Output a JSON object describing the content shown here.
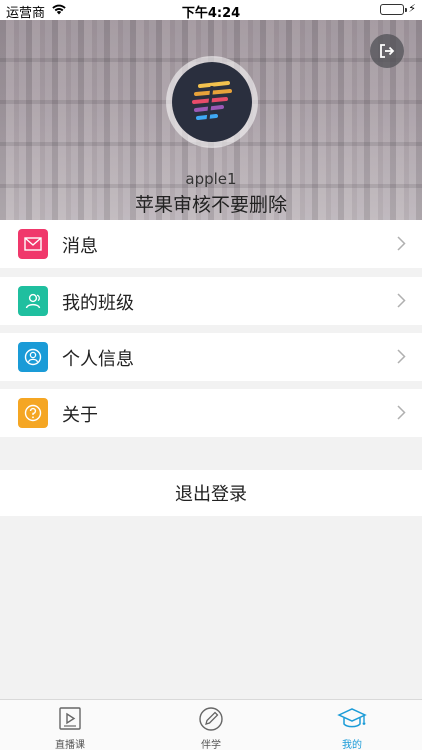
{
  "status_bar": {
    "carrier": "运营商",
    "time": "下午4:24",
    "battery_percent": 100
  },
  "profile": {
    "username": "apple1",
    "signature": "苹果审核不要删除",
    "logout_icon": "logout-icon"
  },
  "menu": {
    "items": [
      {
        "label": "消息",
        "icon": "mail-icon",
        "color": "#f0386b"
      },
      {
        "label": "我的班级",
        "icon": "users-icon",
        "color": "#1fbf9f"
      },
      {
        "label": "个人信息",
        "icon": "profile-icon",
        "color": "#1a9bd7"
      },
      {
        "label": "关于",
        "icon": "question-icon",
        "color": "#f5a623"
      }
    ]
  },
  "logout_label": "退出登录",
  "tabbar": {
    "tabs": [
      {
        "label": "直播课",
        "icon": "play-icon",
        "active": false
      },
      {
        "label": "伴学",
        "icon": "pencil-icon",
        "active": false
      },
      {
        "label": "我的",
        "icon": "graduation-cap-icon",
        "active": true
      }
    ],
    "active_color": "#1a9bd7"
  }
}
